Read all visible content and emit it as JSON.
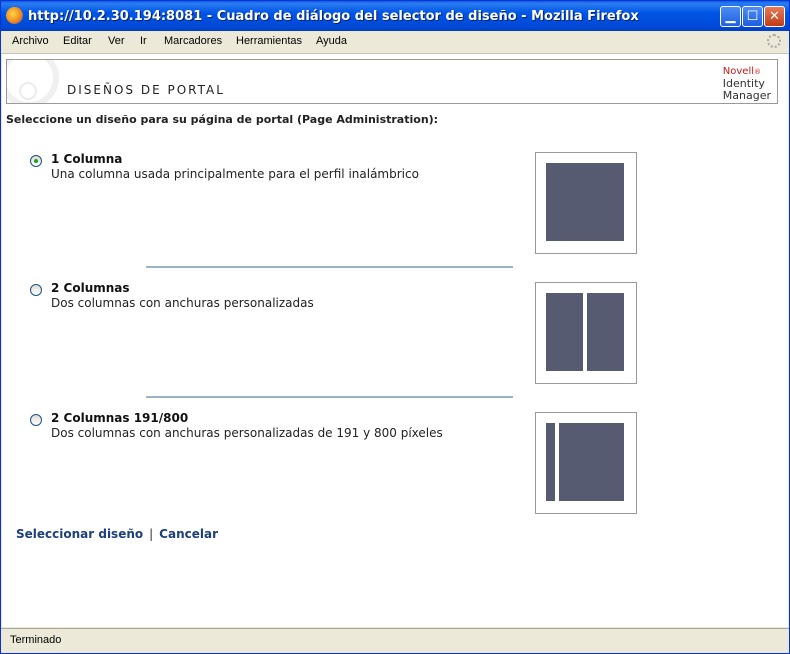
{
  "window": {
    "title": "http://10.2.30.194:8081 - Cuadro de diálogo del selector de diseño - Mozilla Firefox",
    "controls": [
      "minimize-icon",
      "maximize-icon",
      "close-icon"
    ]
  },
  "menu": {
    "items": [
      "Archivo",
      "Editar",
      "Ver",
      "Ir",
      "Marcadores",
      "Herramientas",
      "Ayuda"
    ]
  },
  "banner": {
    "title": "DISEÑOS DE PORTAL",
    "brand": "Novell",
    "brand_mark": "®",
    "product_line1": "Identity",
    "product_line2": "Manager"
  },
  "prompt": "Seleccione un diseño para su página de portal (Page Administration):",
  "layouts": [
    {
      "name": "1 Columna",
      "description": "Una columna usada principalmente para el perfil inalámbrico",
      "selected": true
    },
    {
      "name": "2 Columnas",
      "description": "Dos columnas con anchuras personalizadas",
      "selected": false
    },
    {
      "name": "2 Columnas 191/800",
      "description": "Dos columnas con anchuras personalizadas de 191 y 800 píxeles",
      "selected": false
    }
  ],
  "actions": {
    "select_label": "Seleccionar diseño",
    "separator": "|",
    "cancel_label": "Cancelar"
  },
  "status": "Terminado",
  "colors": {
    "titlebar": "#0055e5",
    "thumbnail_block": "#565b71",
    "divider": "#9bb3c1",
    "link": "#1d3f7a",
    "brand_red": "#c41a1a"
  }
}
